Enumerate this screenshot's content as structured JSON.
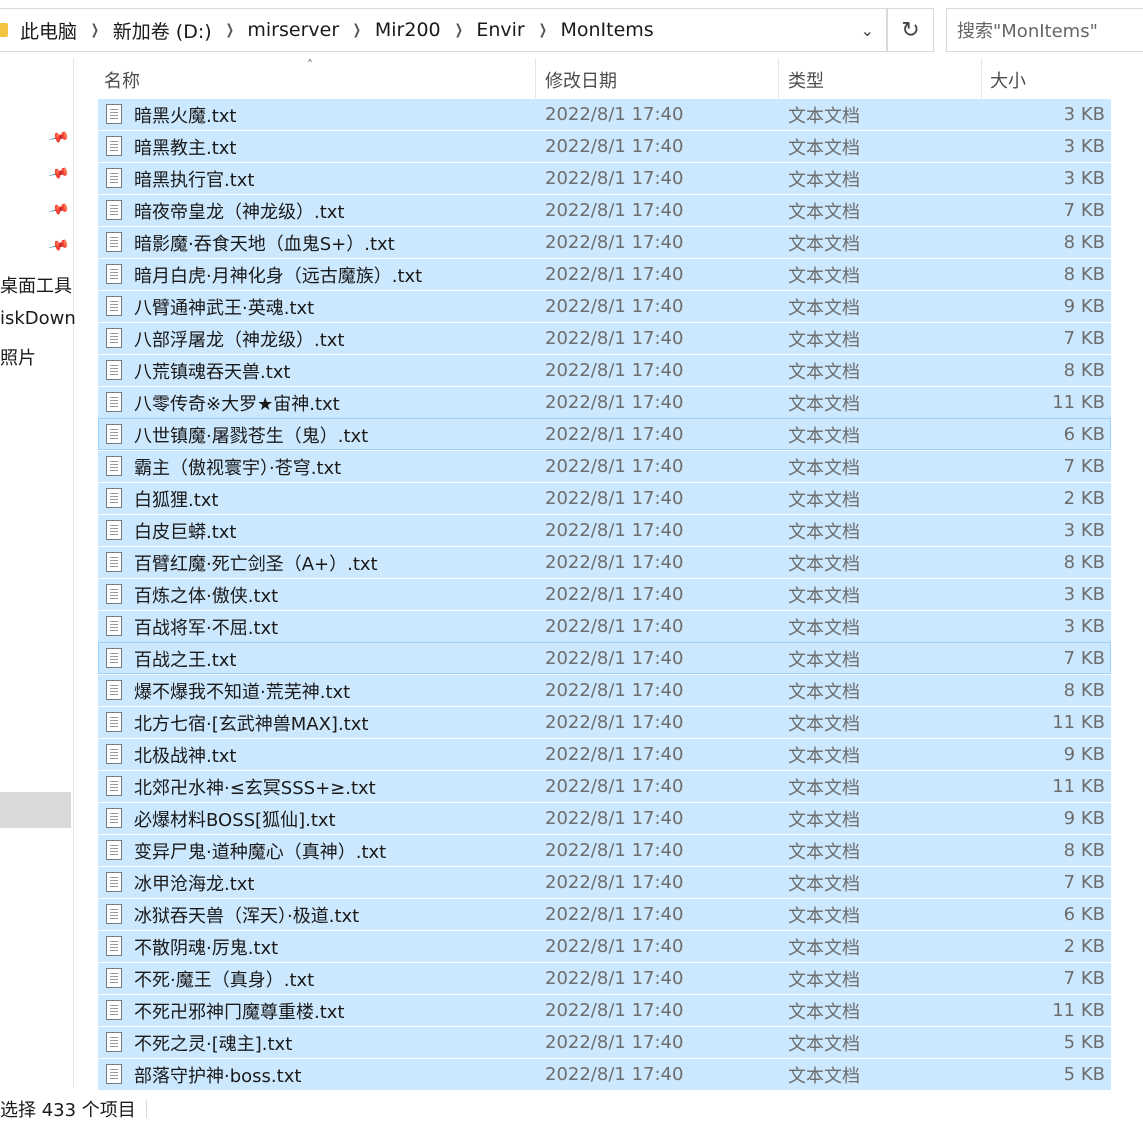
{
  "address": {
    "crumbs": [
      "此电脑",
      "新加卷 (D:)",
      "mirserver",
      "Mir200",
      "Envir",
      "MonItems"
    ],
    "separator": "❯",
    "dropdown_icon": "chevron-down-icon",
    "refresh_icon": "refresh-icon",
    "search_placeholder": "搜索\"MonItems\""
  },
  "sidebar": {
    "labels": [
      "桌面工具",
      "iskDown",
      "照片"
    ]
  },
  "columns": {
    "name": "名称",
    "date": "修改日期",
    "type": "类型",
    "size": "大小",
    "sort_indicator": "^"
  },
  "files": [
    {
      "name": "暗黑火魔.txt",
      "date": "2022/8/1 17:40",
      "type": "文本文档",
      "size": "3 KB"
    },
    {
      "name": "暗黑教主.txt",
      "date": "2022/8/1 17:40",
      "type": "文本文档",
      "size": "3 KB"
    },
    {
      "name": "暗黑执行官.txt",
      "date": "2022/8/1 17:40",
      "type": "文本文档",
      "size": "3 KB"
    },
    {
      "name": "暗夜帝皇龙（神龙级）.txt",
      "date": "2022/8/1 17:40",
      "type": "文本文档",
      "size": "7 KB"
    },
    {
      "name": "暗影魔·吞食天地（血鬼S+）.txt",
      "date": "2022/8/1 17:40",
      "type": "文本文档",
      "size": "8 KB"
    },
    {
      "name": "暗月白虎·月神化身（远古魔族）.txt",
      "date": "2022/8/1 17:40",
      "type": "文本文档",
      "size": "8 KB"
    },
    {
      "name": "八臂通神武王·英魂.txt",
      "date": "2022/8/1 17:40",
      "type": "文本文档",
      "size": "9 KB"
    },
    {
      "name": "八部浮屠龙（神龙级）.txt",
      "date": "2022/8/1 17:40",
      "type": "文本文档",
      "size": "7 KB"
    },
    {
      "name": "八荒镇魂吞天兽.txt",
      "date": "2022/8/1 17:40",
      "type": "文本文档",
      "size": "8 KB"
    },
    {
      "name": "八零传奇※大罗★宙神.txt",
      "date": "2022/8/1 17:40",
      "type": "文本文档",
      "size": "11 KB"
    },
    {
      "name": "八世镇魔·屠戮苍生（鬼）.txt",
      "date": "2022/8/1 17:40",
      "type": "文本文档",
      "size": "6 KB"
    },
    {
      "name": "霸主（傲视寰宇）·苍穹.txt",
      "date": "2022/8/1 17:40",
      "type": "文本文档",
      "size": "7 KB"
    },
    {
      "name": "白狐狸.txt",
      "date": "2022/8/1 17:40",
      "type": "文本文档",
      "size": "2 KB"
    },
    {
      "name": "白皮巨蟒.txt",
      "date": "2022/8/1 17:40",
      "type": "文本文档",
      "size": "3 KB"
    },
    {
      "name": "百臂红魔·死亡剑圣（A+）.txt",
      "date": "2022/8/1 17:40",
      "type": "文本文档",
      "size": "8 KB"
    },
    {
      "name": "百炼之体·傲侠.txt",
      "date": "2022/8/1 17:40",
      "type": "文本文档",
      "size": "3 KB"
    },
    {
      "name": "百战将军·不屈.txt",
      "date": "2022/8/1 17:40",
      "type": "文本文档",
      "size": "3 KB"
    },
    {
      "name": "百战之王.txt",
      "date": "2022/8/1 17:40",
      "type": "文本文档",
      "size": "7 KB"
    },
    {
      "name": "爆不爆我不知道·荒芜神.txt",
      "date": "2022/8/1 17:40",
      "type": "文本文档",
      "size": "8 KB"
    },
    {
      "name": "北方七宿·[玄武神兽MAX].txt",
      "date": "2022/8/1 17:40",
      "type": "文本文档",
      "size": "11 KB"
    },
    {
      "name": "北极战神.txt",
      "date": "2022/8/1 17:40",
      "type": "文本文档",
      "size": "9 KB"
    },
    {
      "name": "北郊卍水神·≤玄冥SSS+≥.txt",
      "date": "2022/8/1 17:40",
      "type": "文本文档",
      "size": "11 KB"
    },
    {
      "name": "必爆材料BOSS[狐仙].txt",
      "date": "2022/8/1 17:40",
      "type": "文本文档",
      "size": "9 KB"
    },
    {
      "name": "变异尸鬼·道种魔心（真神）.txt",
      "date": "2022/8/1 17:40",
      "type": "文本文档",
      "size": "8 KB"
    },
    {
      "name": "冰甲沧海龙.txt",
      "date": "2022/8/1 17:40",
      "type": "文本文档",
      "size": "7 KB"
    },
    {
      "name": "冰狱吞天兽（浑天）·极道.txt",
      "date": "2022/8/1 17:40",
      "type": "文本文档",
      "size": "6 KB"
    },
    {
      "name": "不散阴魂·厉鬼.txt",
      "date": "2022/8/1 17:40",
      "type": "文本文档",
      "size": "2 KB"
    },
    {
      "name": "不死·魔王（真身）.txt",
      "date": "2022/8/1 17:40",
      "type": "文本文档",
      "size": "7 KB"
    },
    {
      "name": "不死卍邪神冂魔尊重楼.txt",
      "date": "2022/8/1 17:40",
      "type": "文本文档",
      "size": "11 KB"
    },
    {
      "name": "不死之灵·[魂主].txt",
      "date": "2022/8/1 17:40",
      "type": "文本文档",
      "size": "5 KB"
    },
    {
      "name": "部落守护神·boss.txt",
      "date": "2022/8/1 17:40",
      "type": "文本文档",
      "size": "5 KB"
    }
  ],
  "status": {
    "text": "选择 433 个项目"
  },
  "colors": {
    "selection": "#cce8ff",
    "focus_border": "#99d1ff"
  }
}
